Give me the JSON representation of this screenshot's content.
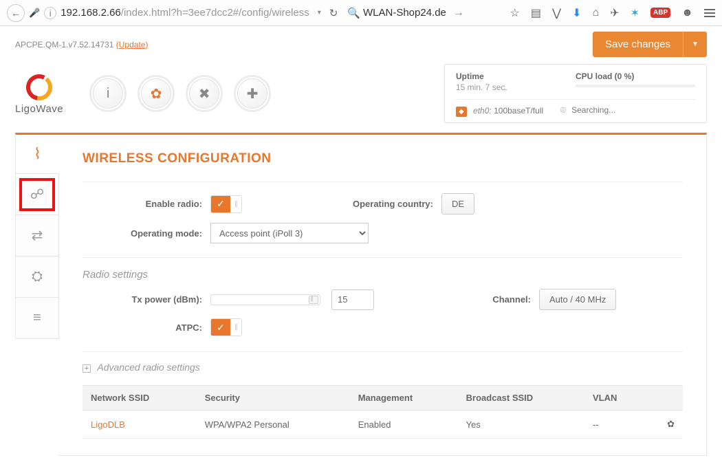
{
  "browser": {
    "url_base": "192.168.2.66",
    "url_path": "/index.html?h=3ee7dcc2#/config/wireless",
    "search_text": "WLAN-Shop24.de"
  },
  "firmware": {
    "version": "APCPE.QM-1.v7.52.14731",
    "update": "(Update)"
  },
  "save_button": "Save changes",
  "status": {
    "uptime_label": "Uptime",
    "uptime_value": "15 min. 7 sec.",
    "cpu_label": "CPU load (0 %)",
    "eth_name": "eth0:",
    "eth_mode": "100baseT/full",
    "wifi_status": "Searching..."
  },
  "logo_name": "LigoWave",
  "page_title": "WIRELESS CONFIGURATION",
  "form": {
    "enable_radio_label": "Enable radio:",
    "operating_country_label": "Operating country:",
    "operating_country_value": "DE",
    "operating_mode_label": "Operating mode:",
    "operating_mode_value": "Access point (iPoll 3)",
    "radio_settings_title": "Radio settings",
    "tx_power_label": "Tx power (dBm):",
    "tx_power_value": "15",
    "channel_label": "Channel:",
    "channel_value": "Auto / 40 MHz",
    "atpc_label": "ATPC:",
    "advanced_title": "Advanced radio settings"
  },
  "table": {
    "headers": {
      "ssid": "Network SSID",
      "security": "Security",
      "management": "Management",
      "broadcast": "Broadcast SSID",
      "vlan": "VLAN"
    },
    "row": {
      "ssid": "LigoDLB",
      "security": "WPA/WPA2 Personal",
      "management": "Enabled",
      "broadcast": "Yes",
      "vlan": "--"
    }
  }
}
